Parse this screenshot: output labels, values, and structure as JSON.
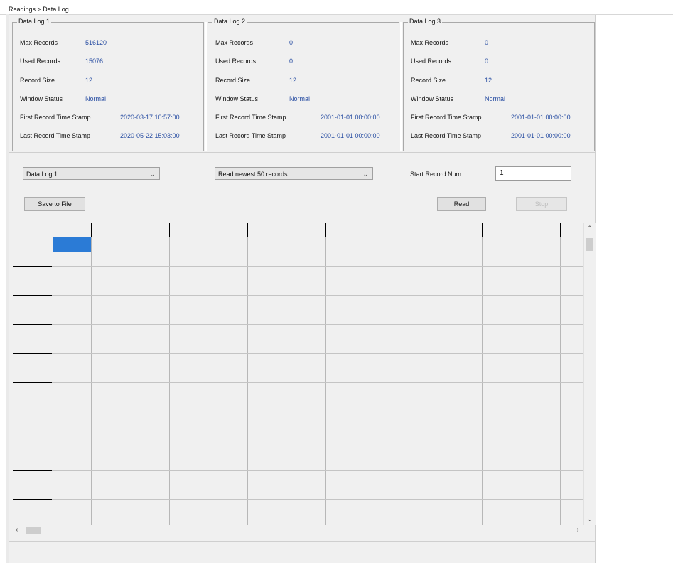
{
  "breadcrumb": "Readings > Data Log",
  "groups": [
    {
      "title": "Data Log 1",
      "rows": [
        {
          "label": "Max Records",
          "value": "516120"
        },
        {
          "label": "Used Records",
          "value": "15076"
        },
        {
          "label": "Record Size",
          "value": "12"
        },
        {
          "label": "Window Status",
          "value": "Normal"
        },
        {
          "label": "First Record Time Stamp",
          "value": "2020-03-17 10:57:00"
        },
        {
          "label": "Last Record Time Stamp",
          "value": "2020-05-22 15:03:00"
        }
      ]
    },
    {
      "title": "Data Log 2",
      "rows": [
        {
          "label": "Max Records",
          "value": "0"
        },
        {
          "label": "Used Records",
          "value": "0"
        },
        {
          "label": "Record Size",
          "value": "12"
        },
        {
          "label": "Window Status",
          "value": "Normal"
        },
        {
          "label": "First Record Time Stamp",
          "value": "2001-01-01 00:00:00"
        },
        {
          "label": "Last Record Time Stamp",
          "value": "2001-01-01 00:00:00"
        }
      ]
    },
    {
      "title": "Data Log 3",
      "rows": [
        {
          "label": "Max Records",
          "value": "0"
        },
        {
          "label": "Used Records",
          "value": "0"
        },
        {
          "label": "Record Size",
          "value": "12"
        },
        {
          "label": "Window Status",
          "value": "Normal"
        },
        {
          "label": "First Record Time Stamp",
          "value": "2001-01-01 00:00:00"
        },
        {
          "label": "Last Record Time Stamp",
          "value": "2001-01-01 00:00:00"
        }
      ]
    }
  ],
  "controls": {
    "log_select": "Data Log 1",
    "read_mode_select": "Read newest 50 records",
    "start_record_label": "Start Record Num",
    "start_record_value": "1",
    "save_button": "Save to File",
    "read_button": "Read",
    "stop_button": "Stop"
  },
  "icons": {
    "dropdown": "chevron-down-icon",
    "scroll_up": "arrow-up-icon",
    "scroll_down": "arrow-down-icon",
    "scroll_left": "arrow-left-icon",
    "scroll_right": "arrow-right-icon"
  },
  "colors": {
    "value_text": "#2a4fa3",
    "selected_cell": "#2b7bd6"
  }
}
